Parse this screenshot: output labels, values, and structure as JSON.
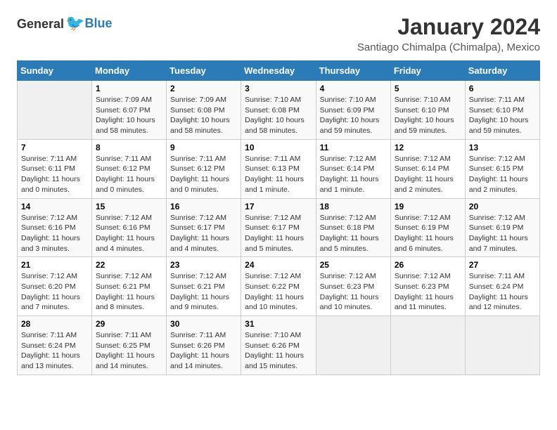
{
  "logo": {
    "general": "General",
    "blue": "Blue"
  },
  "header": {
    "title": "January 2024",
    "subtitle": "Santiago Chimalpa (Chimalpa), Mexico"
  },
  "days_of_week": [
    "Sunday",
    "Monday",
    "Tuesday",
    "Wednesday",
    "Thursday",
    "Friday",
    "Saturday"
  ],
  "weeks": [
    [
      {
        "day": "",
        "info": ""
      },
      {
        "day": "1",
        "info": "Sunrise: 7:09 AM\nSunset: 6:07 PM\nDaylight: 10 hours\nand 58 minutes."
      },
      {
        "day": "2",
        "info": "Sunrise: 7:09 AM\nSunset: 6:08 PM\nDaylight: 10 hours\nand 58 minutes."
      },
      {
        "day": "3",
        "info": "Sunrise: 7:10 AM\nSunset: 6:08 PM\nDaylight: 10 hours\nand 58 minutes."
      },
      {
        "day": "4",
        "info": "Sunrise: 7:10 AM\nSunset: 6:09 PM\nDaylight: 10 hours\nand 59 minutes."
      },
      {
        "day": "5",
        "info": "Sunrise: 7:10 AM\nSunset: 6:10 PM\nDaylight: 10 hours\nand 59 minutes."
      },
      {
        "day": "6",
        "info": "Sunrise: 7:11 AM\nSunset: 6:10 PM\nDaylight: 10 hours\nand 59 minutes."
      }
    ],
    [
      {
        "day": "7",
        "info": "Sunrise: 7:11 AM\nSunset: 6:11 PM\nDaylight: 11 hours\nand 0 minutes."
      },
      {
        "day": "8",
        "info": "Sunrise: 7:11 AM\nSunset: 6:12 PM\nDaylight: 11 hours\nand 0 minutes."
      },
      {
        "day": "9",
        "info": "Sunrise: 7:11 AM\nSunset: 6:12 PM\nDaylight: 11 hours\nand 0 minutes."
      },
      {
        "day": "10",
        "info": "Sunrise: 7:11 AM\nSunset: 6:13 PM\nDaylight: 11 hours\nand 1 minute."
      },
      {
        "day": "11",
        "info": "Sunrise: 7:12 AM\nSunset: 6:14 PM\nDaylight: 11 hours\nand 1 minute."
      },
      {
        "day": "12",
        "info": "Sunrise: 7:12 AM\nSunset: 6:14 PM\nDaylight: 11 hours\nand 2 minutes."
      },
      {
        "day": "13",
        "info": "Sunrise: 7:12 AM\nSunset: 6:15 PM\nDaylight: 11 hours\nand 2 minutes."
      }
    ],
    [
      {
        "day": "14",
        "info": "Sunrise: 7:12 AM\nSunset: 6:16 PM\nDaylight: 11 hours\nand 3 minutes."
      },
      {
        "day": "15",
        "info": "Sunrise: 7:12 AM\nSunset: 6:16 PM\nDaylight: 11 hours\nand 4 minutes."
      },
      {
        "day": "16",
        "info": "Sunrise: 7:12 AM\nSunset: 6:17 PM\nDaylight: 11 hours\nand 4 minutes."
      },
      {
        "day": "17",
        "info": "Sunrise: 7:12 AM\nSunset: 6:17 PM\nDaylight: 11 hours\nand 5 minutes."
      },
      {
        "day": "18",
        "info": "Sunrise: 7:12 AM\nSunset: 6:18 PM\nDaylight: 11 hours\nand 5 minutes."
      },
      {
        "day": "19",
        "info": "Sunrise: 7:12 AM\nSunset: 6:19 PM\nDaylight: 11 hours\nand 6 minutes."
      },
      {
        "day": "20",
        "info": "Sunrise: 7:12 AM\nSunset: 6:19 PM\nDaylight: 11 hours\nand 7 minutes."
      }
    ],
    [
      {
        "day": "21",
        "info": "Sunrise: 7:12 AM\nSunset: 6:20 PM\nDaylight: 11 hours\nand 7 minutes."
      },
      {
        "day": "22",
        "info": "Sunrise: 7:12 AM\nSunset: 6:21 PM\nDaylight: 11 hours\nand 8 minutes."
      },
      {
        "day": "23",
        "info": "Sunrise: 7:12 AM\nSunset: 6:21 PM\nDaylight: 11 hours\nand 9 minutes."
      },
      {
        "day": "24",
        "info": "Sunrise: 7:12 AM\nSunset: 6:22 PM\nDaylight: 11 hours\nand 10 minutes."
      },
      {
        "day": "25",
        "info": "Sunrise: 7:12 AM\nSunset: 6:23 PM\nDaylight: 11 hours\nand 10 minutes."
      },
      {
        "day": "26",
        "info": "Sunrise: 7:12 AM\nSunset: 6:23 PM\nDaylight: 11 hours\nand 11 minutes."
      },
      {
        "day": "27",
        "info": "Sunrise: 7:11 AM\nSunset: 6:24 PM\nDaylight: 11 hours\nand 12 minutes."
      }
    ],
    [
      {
        "day": "28",
        "info": "Sunrise: 7:11 AM\nSunset: 6:24 PM\nDaylight: 11 hours\nand 13 minutes."
      },
      {
        "day": "29",
        "info": "Sunrise: 7:11 AM\nSunset: 6:25 PM\nDaylight: 11 hours\nand 14 minutes."
      },
      {
        "day": "30",
        "info": "Sunrise: 7:11 AM\nSunset: 6:26 PM\nDaylight: 11 hours\nand 14 minutes."
      },
      {
        "day": "31",
        "info": "Sunrise: 7:10 AM\nSunset: 6:26 PM\nDaylight: 11 hours\nand 15 minutes."
      },
      {
        "day": "",
        "info": ""
      },
      {
        "day": "",
        "info": ""
      },
      {
        "day": "",
        "info": ""
      }
    ]
  ]
}
